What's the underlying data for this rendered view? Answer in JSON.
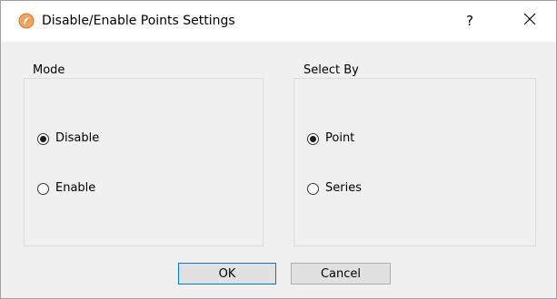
{
  "window": {
    "title": "Disable/Enable Points Settings",
    "help_label": "?",
    "app_icon": "orange-logo-icon",
    "close_icon": "close-icon"
  },
  "mode_group": {
    "title": "Mode",
    "options": [
      {
        "label": "Disable",
        "checked": true
      },
      {
        "label": "Enable",
        "checked": false
      }
    ]
  },
  "select_by_group": {
    "title": "Select By",
    "options": [
      {
        "label": "Point",
        "checked": true
      },
      {
        "label": "Series",
        "checked": false
      }
    ]
  },
  "buttons": {
    "ok_label": "OK",
    "cancel_label": "Cancel"
  },
  "colors": {
    "accent": "#0078d7",
    "icon_orange": "#e8883a"
  }
}
